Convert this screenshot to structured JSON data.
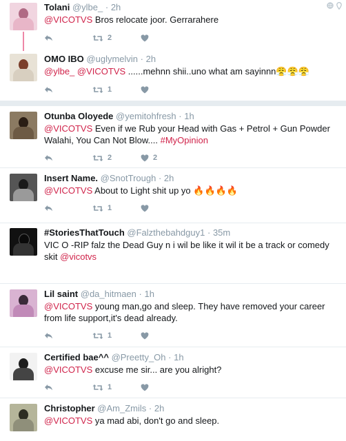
{
  "tweets": [
    {
      "fullname": "Tolani",
      "username": "@ylbe_",
      "sep": "·",
      "time": "2h",
      "mention": "@VICOTVS",
      "text": " Bros relocate joor. Gerrarahere",
      "retweets": "2",
      "likes": "",
      "colors": [
        "#e8b6c8",
        "#b06a84"
      ]
    },
    {
      "fullname": "OMO IBO",
      "username": "@uglymelvin",
      "sep": "·",
      "time": "2h",
      "mention": "@ylbe_",
      "mention2": "@VICOTVS",
      "text": " ......mehnn shii..uno what am sayinnn😤😤😤",
      "retweets": "1",
      "likes": "",
      "colors": [
        "#d8cfc0",
        "#7b3f2b"
      ]
    },
    {
      "fullname": "Otunba Oloyede",
      "username": "@yemitohfresh",
      "sep": "·",
      "time": "1h",
      "mention": "@VICOTVS",
      "text": " Even if we Rub your Head with Gas + Petrol + Gun Powder Walahi, You Can Not Blow.... ",
      "hashtag": "#MyOpinion",
      "retweets": "2",
      "likes": "2",
      "colors": [
        "#6d5a44",
        "#2a1d14"
      ]
    },
    {
      "fullname": "Insert Name.",
      "username": "@SnotTrough",
      "sep": "·",
      "time": "2h",
      "mention": "@VICOTVS",
      "text": " About to Light shit up yo 🔥🔥🔥🔥",
      "retweets": "1",
      "likes": "",
      "colors": [
        "#9a9a9a",
        "#1a1a1a"
      ]
    },
    {
      "fullname": "#StoriesThatTouch",
      "username": "@Falzthebahdguy1",
      "sep": "·",
      "time": "35m",
      "text": "VIC O -RIP falz the Dead Guy n i wil be like it wil it be a track or comedy skit ",
      "mention": "@vicotvs",
      "retweets": "",
      "likes": "",
      "colors": [
        "#333333",
        "#0a0a0a"
      ]
    },
    {
      "fullname": "Lil saint",
      "username": "@da_hitmaen",
      "sep": "·",
      "time": "1h",
      "mention": "@VICOTVS",
      "text": " young man,go and sleep. They have removed your career from life support,it's dead already.",
      "retweets": "1",
      "likes": "",
      "colors": [
        "#c18ab8",
        "#3b2a3a"
      ]
    },
    {
      "fullname": "Certified bae^^",
      "username": "@Preetty_Oh",
      "sep": "·",
      "time": "1h",
      "mention": "@VICOTVS",
      "text": " excuse me sir... are you alright?",
      "retweets": "1",
      "likes": "",
      "colors": [
        "#f2f2f2",
        "#1d1d1d"
      ]
    },
    {
      "fullname": "Christopher",
      "username": "@Am_Zmils",
      "sep": "·",
      "time": "2h",
      "mention": "@VICOTVS",
      "text": " ya mad abi, don't go and sleep.",
      "retweets": "",
      "likes": "",
      "colors": [
        "#8f8f7a",
        "#2d2d22"
      ]
    }
  ]
}
